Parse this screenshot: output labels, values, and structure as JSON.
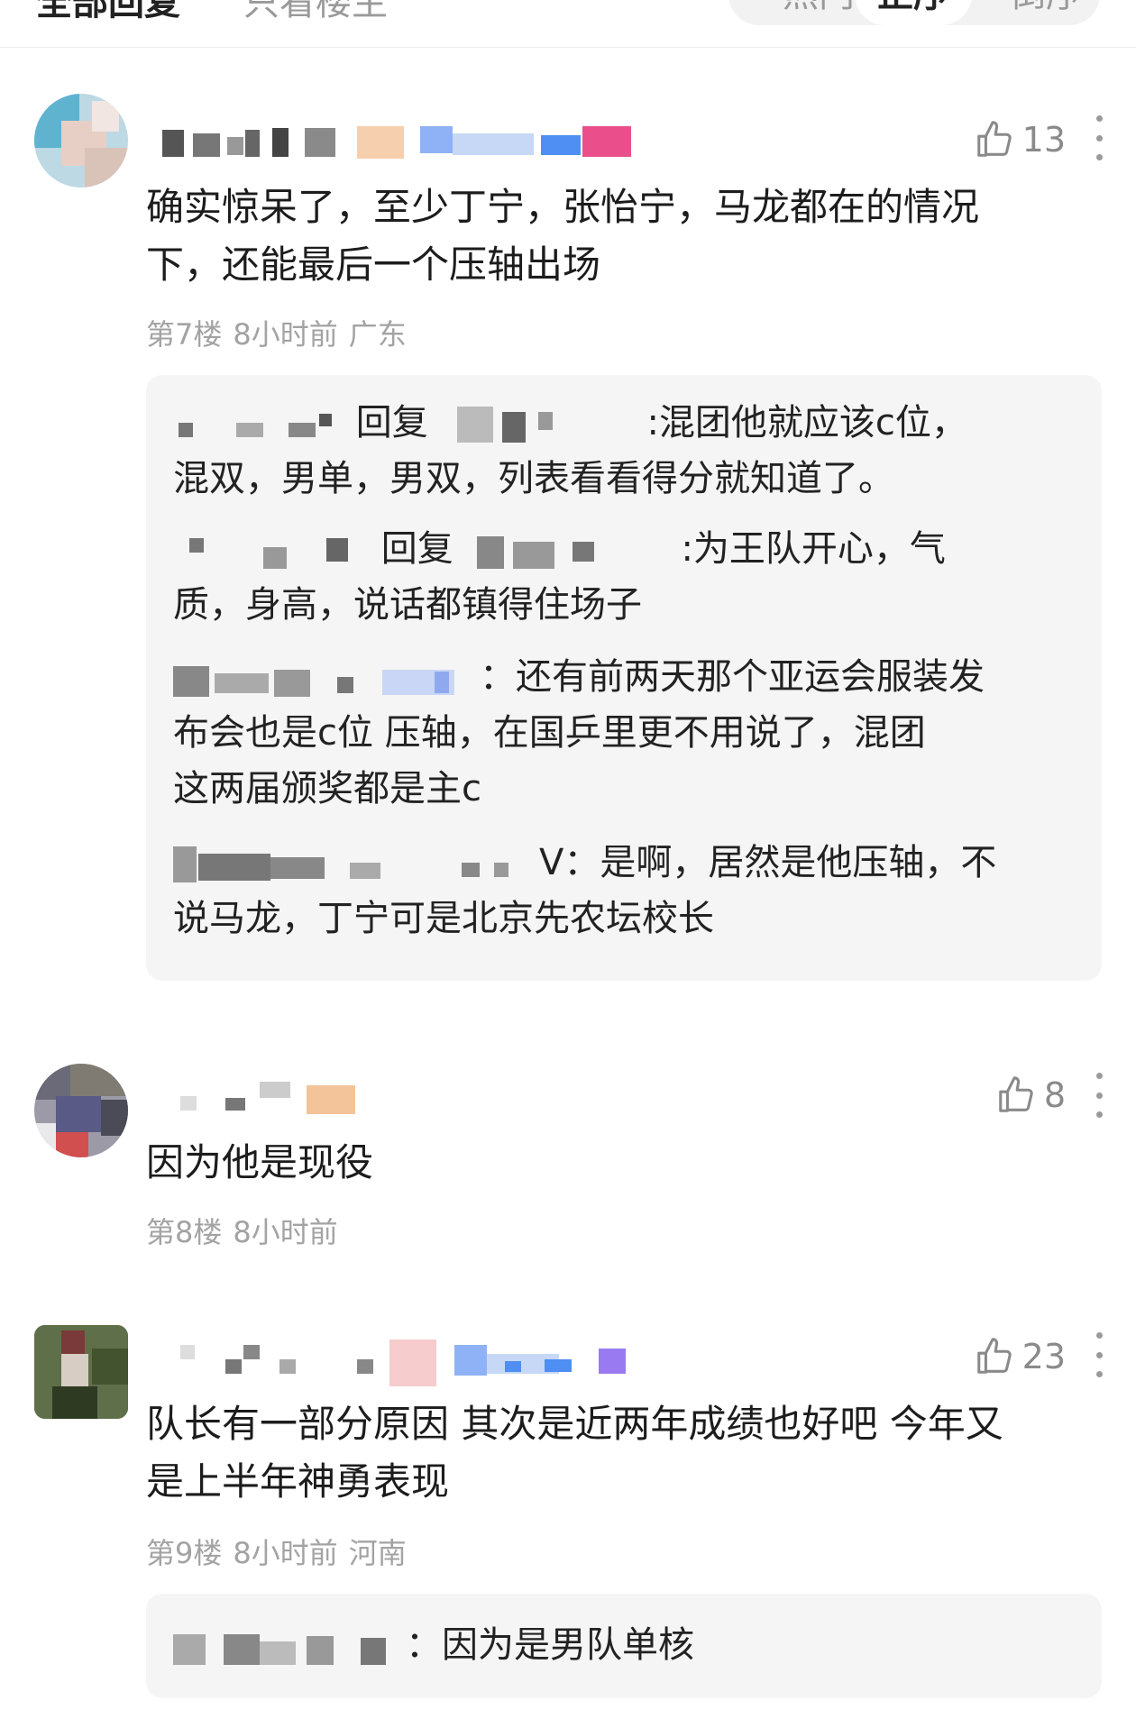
{
  "header": {
    "title": "全部回复",
    "subtitle": "只看楼主",
    "sort_options": [
      "热门",
      "正序",
      "倒序"
    ]
  },
  "comments": [
    {
      "likes": "13",
      "text_lines": [
        "确实惊呆了，至少丁宁，张怡宁，马龙都在的情况",
        "下，还能最后一个压轴出场"
      ],
      "floor": "第7楼",
      "time": "8小时前",
      "location": "广东",
      "replies": [
        {
          "prefix": "回复",
          "text_lines": [
            ":混团他就应该c位，",
            "混双，男单，男双，列表看看得分就知道了。"
          ]
        },
        {
          "prefix": "回复",
          "text_lines": [
            ":为王队开心，气",
            "质，身高，说话都镇得住场子"
          ]
        },
        {
          "prefix": "",
          "text_lines": [
            "：还有前两天那个亚运会服装发",
            "布会也是c位 压轴，在国乒里更不用说了，混团",
            "这两届颁奖都是主c"
          ]
        },
        {
          "prefix": "",
          "text_lines": [
            "V：是啊，居然是他压轴，不",
            "说马龙，丁宁可是北京先农坛校长"
          ]
        }
      ]
    },
    {
      "likes": "8",
      "text_lines": [
        "因为他是现役"
      ],
      "floor": "第8楼",
      "time": "8小时前",
      "location": ""
    },
    {
      "likes": "23",
      "text_lines": [
        "队长有一部分原因 其次是近两年成绩也好吧 今年又",
        "是上半年神勇表现"
      ],
      "floor": "第9楼",
      "time": "8小时前",
      "location": "河南",
      "replies": [
        {
          "prefix": "",
          "text_lines": [
            "：因为是男队单核"
          ]
        }
      ]
    }
  ],
  "colors": {
    "meta_gray": "#a3a3a3",
    "reply_bg": "#f5f5f6",
    "icon_gray": "#8a8a8a"
  },
  "icons": [
    "thumb-up-icon",
    "more-vertical-icon"
  ]
}
